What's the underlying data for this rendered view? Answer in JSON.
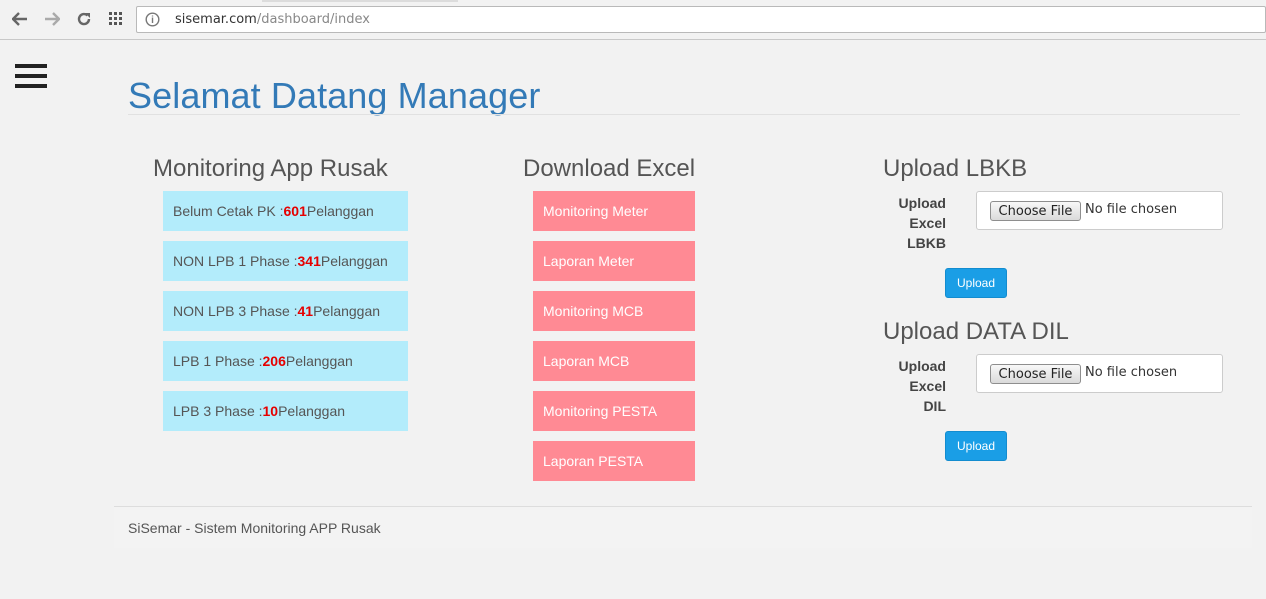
{
  "browser": {
    "url_host": "sisemar.com",
    "url_path": "/dashboard/index"
  },
  "page": {
    "title": "Selamat Datang Manager"
  },
  "monitoring": {
    "title": "Monitoring App Rusak",
    "items": [
      {
        "label": "Belum Cetak PK : ",
        "count": "601",
        "suffix": " Pelanggan"
      },
      {
        "label": "NON LPB 1 Phase : ",
        "count": "341",
        "suffix": " Pelanggan"
      },
      {
        "label": "NON LPB 3 Phase : ",
        "count": "41",
        "suffix": " Pelanggan"
      },
      {
        "label": "LPB 1 Phase : ",
        "count": "206",
        "suffix": " Pelanggan"
      },
      {
        "label": "LPB 3 Phase : ",
        "count": "10",
        "suffix": " Pelanggan"
      }
    ]
  },
  "download": {
    "title": "Download Excel",
    "items": [
      "Monitoring Meter",
      "Laporan Meter",
      "Monitoring MCB",
      "Laporan MCB",
      "Monitoring PESTA",
      "Laporan PESTA"
    ]
  },
  "upload_lbkb": {
    "title": "Upload LBKB",
    "label_lines": [
      "Upload",
      "Excel",
      "LBKB"
    ],
    "file_button": "Choose File",
    "file_status": "No file chosen",
    "submit": "Upload"
  },
  "upload_dil": {
    "title": "Upload DATA DIL",
    "label_lines": [
      "Upload",
      "Excel",
      "DIL"
    ],
    "file_button": "Choose File",
    "file_status": "No file chosen",
    "submit": "Upload"
  },
  "footer": {
    "text": "SiSemar - Sistem Monitoring APP Rusak"
  },
  "colors": {
    "title_blue": "#337ab7",
    "stat_bg": "#b3ecfb",
    "stat_count": "#e60000",
    "download_bg": "#ff8a94",
    "upload_button": "#1a9ee6"
  }
}
